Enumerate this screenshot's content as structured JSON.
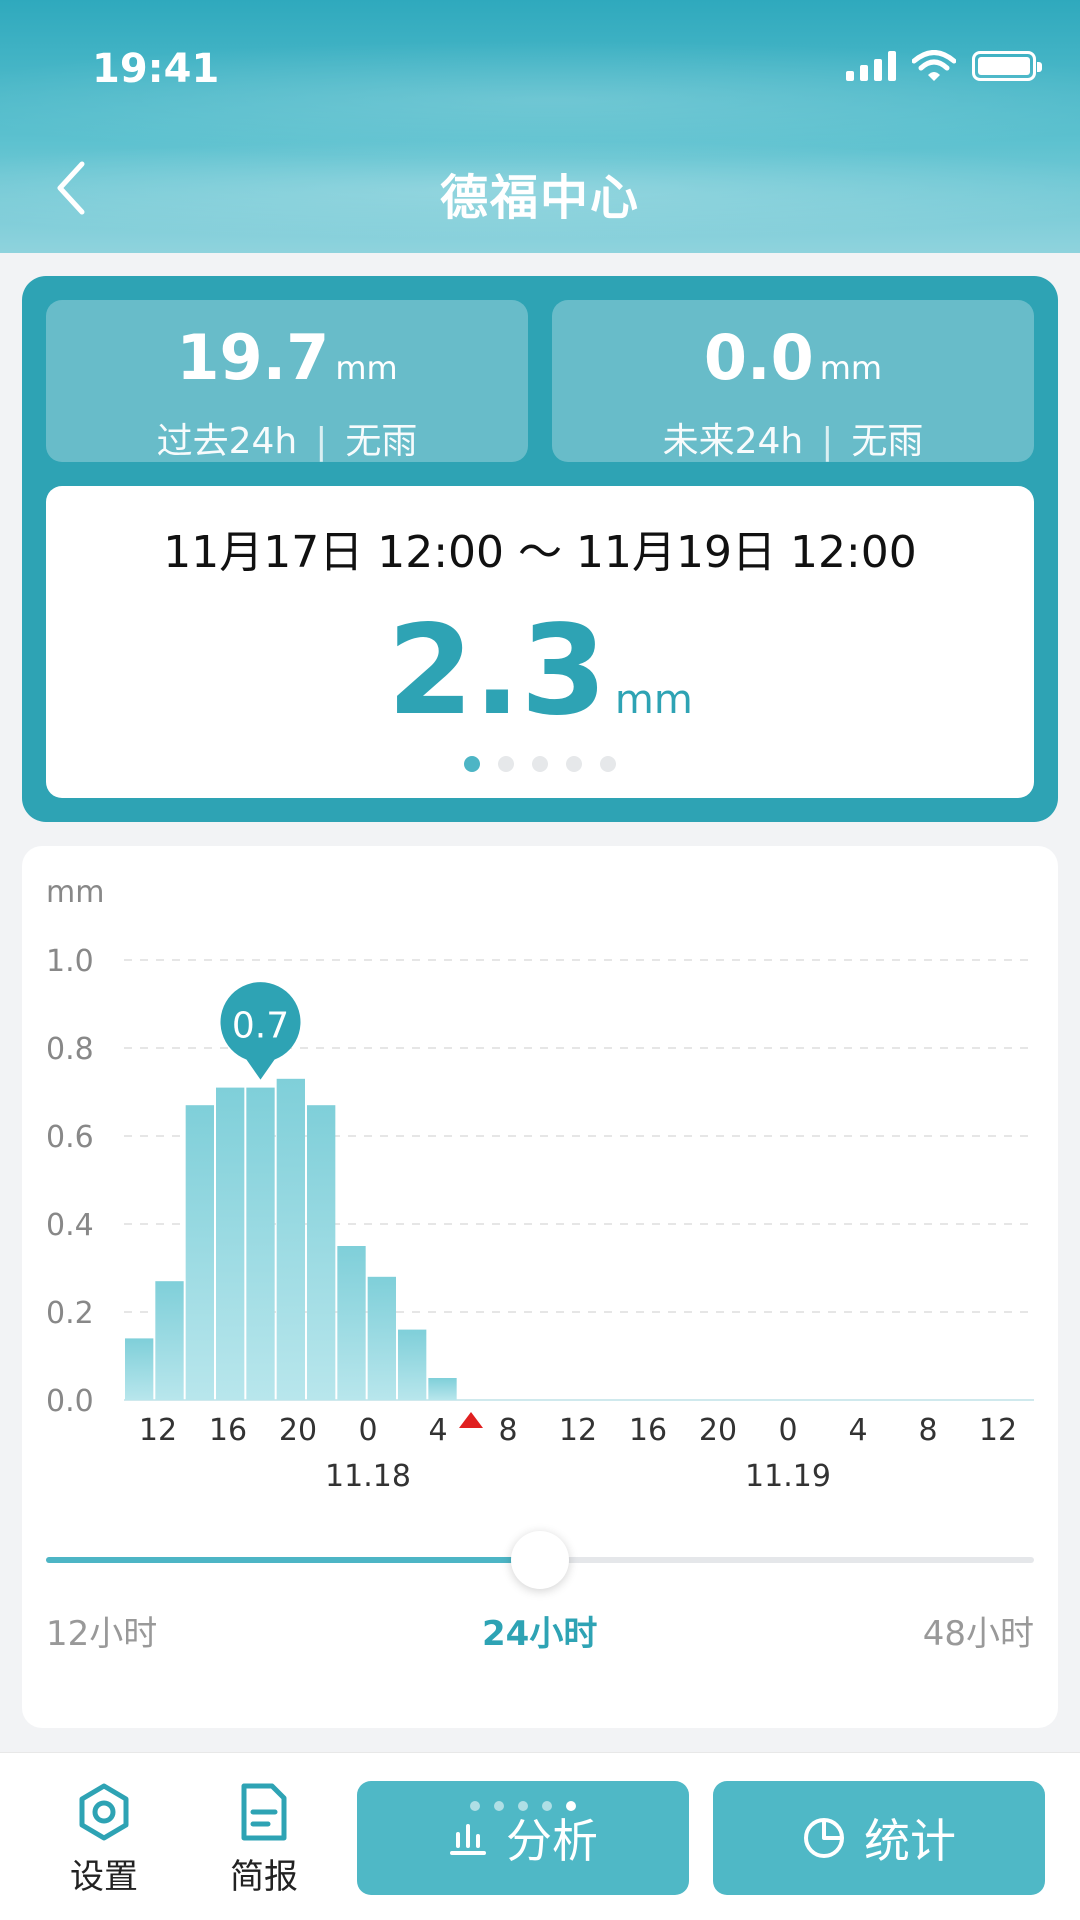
{
  "status_bar": {
    "time": "19:41"
  },
  "header": {
    "title": "德福中心"
  },
  "summary": {
    "past": {
      "value": "19.7",
      "unit": "mm",
      "period": "过去24h",
      "condition": "无雨"
    },
    "future": {
      "value": "0.0",
      "unit": "mm",
      "period": "未来24h",
      "condition": "无雨"
    },
    "range": {
      "text": "11月17日 12:00 ～ 11月19日 12:00",
      "value": "2.3",
      "unit": "mm"
    },
    "pager": {
      "count": 5,
      "active": 0
    }
  },
  "chart_data": {
    "type": "bar",
    "ylabel": "mm",
    "ylim": [
      0,
      1.0
    ],
    "yticks": [
      "0.0",
      "0.2",
      "0.4",
      "0.6",
      "0.8",
      "1.0"
    ],
    "grid": true,
    "x_hours": [
      10,
      11,
      12,
      13,
      14,
      15,
      16,
      17,
      18,
      19,
      20,
      21,
      22,
      23,
      0,
      1,
      2,
      3,
      4,
      5,
      6,
      7,
      8,
      9,
      10,
      11,
      12,
      13,
      14,
      15,
      16,
      17,
      18,
      19,
      20,
      21,
      22,
      23,
      0,
      1,
      2,
      3,
      4,
      5,
      6,
      7,
      8,
      9,
      10,
      11,
      12
    ],
    "values": [
      0.14,
      0.27,
      0.67,
      0.71,
      0.71,
      0.73,
      0.67,
      0.35,
      0.28,
      0.16,
      0.05,
      0,
      0,
      0,
      0,
      0,
      0,
      0,
      0,
      0,
      0,
      0,
      0,
      0,
      0,
      0,
      0,
      0,
      0,
      0
    ],
    "xtick_labels": [
      "12",
      "16",
      "20",
      "0",
      "4",
      "8",
      "12",
      "16",
      "20",
      "0",
      "4",
      "8",
      "12"
    ],
    "date_labels": [
      "11.18",
      "11.19"
    ],
    "highlight": {
      "index": 4,
      "label": "0.7"
    },
    "now_marker_after_tick": "4",
    "bar_color": "#7fcfd9",
    "highlight_color": "#2ea3b4",
    "marker_color": "#e02020"
  },
  "range_slider": {
    "labels": [
      "12小时",
      "24小时",
      "48小时"
    ],
    "selected": "24小时",
    "position": 0.5
  },
  "bottom_bar": {
    "settings_label": "设置",
    "report_label": "简报",
    "analysis_label": "分析",
    "statistics_label": "统计"
  },
  "colors": {
    "accent": "#2ea3b4",
    "accent_light": "#4fb8c6"
  }
}
